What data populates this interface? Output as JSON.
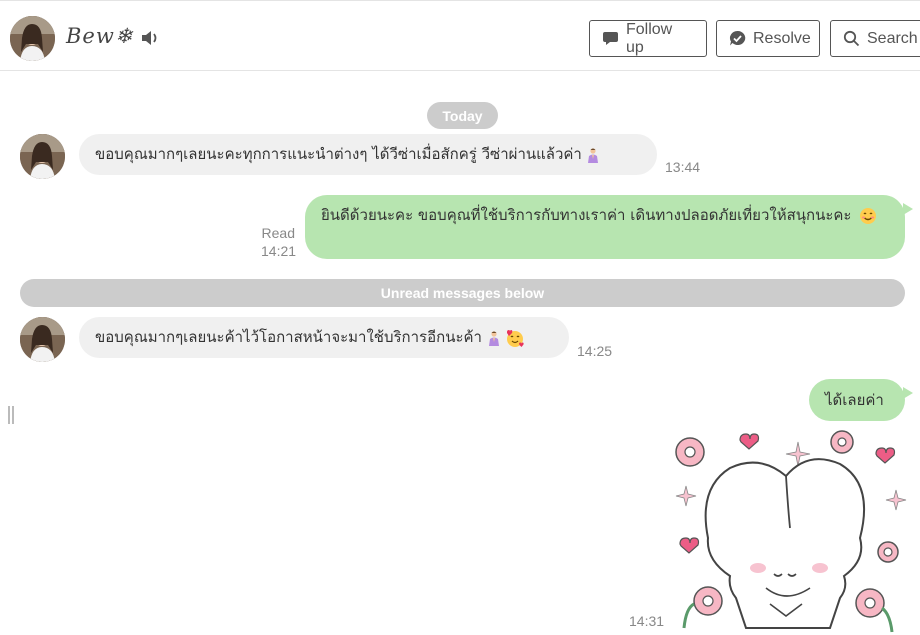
{
  "header": {
    "contact_name": "Bew❄",
    "follow_up_label": "Follow up",
    "resolve_label": "Resolve",
    "search_label": "Search"
  },
  "dividers": {
    "today": "Today",
    "unread": "Unread messages below"
  },
  "messages": [
    {
      "direction": "in",
      "text": "ขอบคุณมากๆเลยนะคะทุกการแนะนำต่างๆ ได้วีซ่าเมื่อสักครู่ วีซ่าผ่านแล้วค่า",
      "emoji": "woman-pray",
      "time": "13:44"
    },
    {
      "direction": "out",
      "text": "ยินดีด้วยนะคะ ขอบคุณที่ใช้บริการกับทางเราค่า เดินทางปลอดภัยเที่ยวให้สนุกนะคะ",
      "emoji": "smiling-face",
      "status": "Read",
      "time": "14:21"
    },
    {
      "direction": "in",
      "text": "ขอบคุณมากๆเลยนะค้าไว้โอกาสหน้าจะมาใช้บริการอีกนะค้า",
      "emoji": "woman-pray, face-with-hearts",
      "time": "14:25"
    },
    {
      "direction": "out",
      "text": "ได้เลยค่า"
    },
    {
      "direction": "out",
      "type": "sticker",
      "sticker": "bunny-bow-with-hearts-and-flowers",
      "time": "14:31"
    }
  ],
  "colors": {
    "outgoing_bubble": "#b7e5b0",
    "incoming_bubble": "#f0f0f0",
    "divider_pill": "#cccccc"
  }
}
